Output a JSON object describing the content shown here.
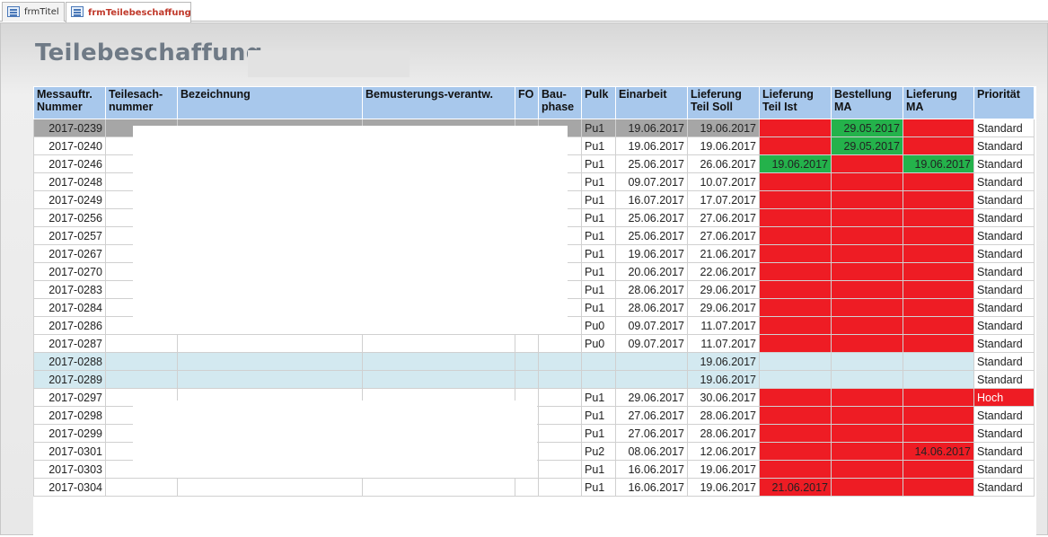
{
  "tabs": [
    {
      "label": "frmTitel"
    },
    {
      "label": "frmTeilebeschaffung"
    }
  ],
  "form": {
    "title": "Teilebeschaffung"
  },
  "colors": {
    "header_bg": "#a8c8ec",
    "status_red": "#ee1c24",
    "status_green": "#24b24b",
    "selected_row": "#a6a6a6",
    "highlight_row": "#d3e9f0"
  },
  "table": {
    "headers": [
      "Messauftr. Nummer",
      "Teilesach- nummer",
      "Bezeichnung",
      "Bemusterungs-verantw.",
      "FO",
      "Bau- phase",
      "Pulk",
      "Einarbeit",
      "Lieferung Teil Soll",
      "Lieferung Teil Ist",
      "Bestellung MA",
      "Lieferung MA",
      "Priorität"
    ],
    "rows": [
      {
        "nr": "2017-0239",
        "pulk": "Pu1",
        "einarbeit": "19.06.2017",
        "soll": "19.06.2017",
        "ist": "",
        "bestellung": "29.05.2017",
        "liefma": "",
        "prio": "Standard",
        "ist_s": "red",
        "best_s": "green",
        "lm_s": "red",
        "prio_s": "white",
        "row_s": "sel"
      },
      {
        "nr": "2017-0240",
        "pulk": "Pu1",
        "einarbeit": "19.06.2017",
        "soll": "19.06.2017",
        "ist": "",
        "bestellung": "29.05.2017",
        "liefma": "",
        "prio": "Standard",
        "ist_s": "red",
        "best_s": "green",
        "lm_s": "red",
        "prio_s": "white",
        "row_s": ""
      },
      {
        "nr": "2017-0246",
        "pulk": "Pu1",
        "einarbeit": "25.06.2017",
        "soll": "26.06.2017",
        "ist": "19.06.2017",
        "bestellung": "",
        "liefma": "19.06.2017",
        "prio": "Standard",
        "ist_s": "green",
        "best_s": "red",
        "lm_s": "green",
        "prio_s": "white",
        "row_s": ""
      },
      {
        "nr": "2017-0248",
        "pulk": "Pu1",
        "einarbeit": "09.07.2017",
        "soll": "10.07.2017",
        "ist": "",
        "bestellung": "",
        "liefma": "",
        "prio": "Standard",
        "ist_s": "red",
        "best_s": "red",
        "lm_s": "red",
        "prio_s": "white",
        "row_s": ""
      },
      {
        "nr": "2017-0249",
        "pulk": "Pu1",
        "einarbeit": "16.07.2017",
        "soll": "17.07.2017",
        "ist": "",
        "bestellung": "",
        "liefma": "",
        "prio": "Standard",
        "ist_s": "red",
        "best_s": "red",
        "lm_s": "red",
        "prio_s": "white",
        "row_s": ""
      },
      {
        "nr": "2017-0256",
        "pulk": "Pu1",
        "einarbeit": "25.06.2017",
        "soll": "27.06.2017",
        "ist": "",
        "bestellung": "",
        "liefma": "",
        "prio": "Standard",
        "ist_s": "red",
        "best_s": "red",
        "lm_s": "red",
        "prio_s": "white",
        "row_s": ""
      },
      {
        "nr": "2017-0257",
        "pulk": "Pu1",
        "einarbeit": "25.06.2017",
        "soll": "27.06.2017",
        "ist": "",
        "bestellung": "",
        "liefma": "",
        "prio": "Standard",
        "ist_s": "red",
        "best_s": "red",
        "lm_s": "red",
        "prio_s": "white",
        "row_s": ""
      },
      {
        "nr": "2017-0267",
        "pulk": "Pu1",
        "einarbeit": "19.06.2017",
        "soll": "21.06.2017",
        "ist": "",
        "bestellung": "",
        "liefma": "",
        "prio": "Standard",
        "ist_s": "red",
        "best_s": "red",
        "lm_s": "red",
        "prio_s": "white",
        "row_s": ""
      },
      {
        "nr": "2017-0270",
        "pulk": "Pu1",
        "einarbeit": "20.06.2017",
        "soll": "22.06.2017",
        "ist": "",
        "bestellung": "",
        "liefma": "",
        "prio": "Standard",
        "ist_s": "red",
        "best_s": "red",
        "lm_s": "red",
        "prio_s": "white",
        "row_s": ""
      },
      {
        "nr": "2017-0283",
        "pulk": "Pu1",
        "einarbeit": "28.06.2017",
        "soll": "29.06.2017",
        "ist": "",
        "bestellung": "",
        "liefma": "",
        "prio": "Standard",
        "ist_s": "red",
        "best_s": "red",
        "lm_s": "red",
        "prio_s": "white",
        "row_s": ""
      },
      {
        "nr": "2017-0284",
        "pulk": "Pu1",
        "einarbeit": "28.06.2017",
        "soll": "29.06.2017",
        "ist": "",
        "bestellung": "",
        "liefma": "",
        "prio": "Standard",
        "ist_s": "red",
        "best_s": "red",
        "lm_s": "red",
        "prio_s": "white",
        "row_s": ""
      },
      {
        "nr": "2017-0286",
        "pulk": "Pu0",
        "einarbeit": "09.07.2017",
        "soll": "11.07.2017",
        "ist": "",
        "bestellung": "",
        "liefma": "",
        "prio": "Standard",
        "ist_s": "red",
        "best_s": "red",
        "lm_s": "red",
        "prio_s": "white",
        "row_s": ""
      },
      {
        "nr": "2017-0287",
        "pulk": "Pu0",
        "einarbeit": "09.07.2017",
        "soll": "11.07.2017",
        "ist": "",
        "bestellung": "",
        "liefma": "",
        "prio": "Standard",
        "ist_s": "red",
        "best_s": "red",
        "lm_s": "red",
        "prio_s": "white",
        "row_s": ""
      },
      {
        "nr": "2017-0288",
        "pulk": "",
        "einarbeit": "",
        "soll": "19.06.2017",
        "ist": "",
        "bestellung": "",
        "liefma": "",
        "prio": "Standard",
        "ist_s": "",
        "best_s": "",
        "lm_s": "",
        "prio_s": "white",
        "row_s": "hl"
      },
      {
        "nr": "2017-0289",
        "pulk": "",
        "einarbeit": "",
        "soll": "19.06.2017",
        "ist": "",
        "bestellung": "",
        "liefma": "",
        "prio": "Standard",
        "ist_s": "",
        "best_s": "",
        "lm_s": "",
        "prio_s": "white",
        "row_s": "hl"
      },
      {
        "nr": "2017-0297",
        "pulk": "Pu1",
        "einarbeit": "29.06.2017",
        "soll": "30.06.2017",
        "ist": "",
        "bestellung": "",
        "liefma": "",
        "prio": "Hoch",
        "ist_s": "red",
        "best_s": "red",
        "lm_s": "red",
        "prio_s": "prio-hoch",
        "row_s": ""
      },
      {
        "nr": "2017-0298",
        "pulk": "Pu1",
        "einarbeit": "27.06.2017",
        "soll": "28.06.2017",
        "ist": "",
        "bestellung": "",
        "liefma": "",
        "prio": "Standard",
        "ist_s": "red",
        "best_s": "red",
        "lm_s": "red",
        "prio_s": "white",
        "row_s": ""
      },
      {
        "nr": "2017-0299",
        "pulk": "Pu1",
        "einarbeit": "27.06.2017",
        "soll": "28.06.2017",
        "ist": "",
        "bestellung": "",
        "liefma": "",
        "prio": "Standard",
        "ist_s": "red",
        "best_s": "red",
        "lm_s": "red",
        "prio_s": "white",
        "row_s": ""
      },
      {
        "nr": "2017-0301",
        "pulk": "Pu2",
        "einarbeit": "08.06.2017",
        "soll": "12.06.2017",
        "ist": "",
        "bestellung": "",
        "liefma": "14.06.2017",
        "prio": "Standard",
        "ist_s": "red",
        "best_s": "red",
        "lm_s": "red",
        "prio_s": "white",
        "row_s": ""
      },
      {
        "nr": "2017-0303",
        "pulk": "Pu1",
        "einarbeit": "16.06.2017",
        "soll": "19.06.2017",
        "ist": "",
        "bestellung": "",
        "liefma": "",
        "prio": "Standard",
        "ist_s": "red",
        "best_s": "red",
        "lm_s": "red",
        "prio_s": "white",
        "row_s": ""
      },
      {
        "nr": "2017-0304",
        "pulk": "Pu1",
        "einarbeit": "16.06.2017",
        "soll": "19.06.2017",
        "ist": "21.06.2017",
        "bestellung": "",
        "liefma": "",
        "prio": "Standard",
        "ist_s": "red",
        "best_s": "red",
        "lm_s": "red",
        "prio_s": "white",
        "row_s": ""
      }
    ]
  }
}
